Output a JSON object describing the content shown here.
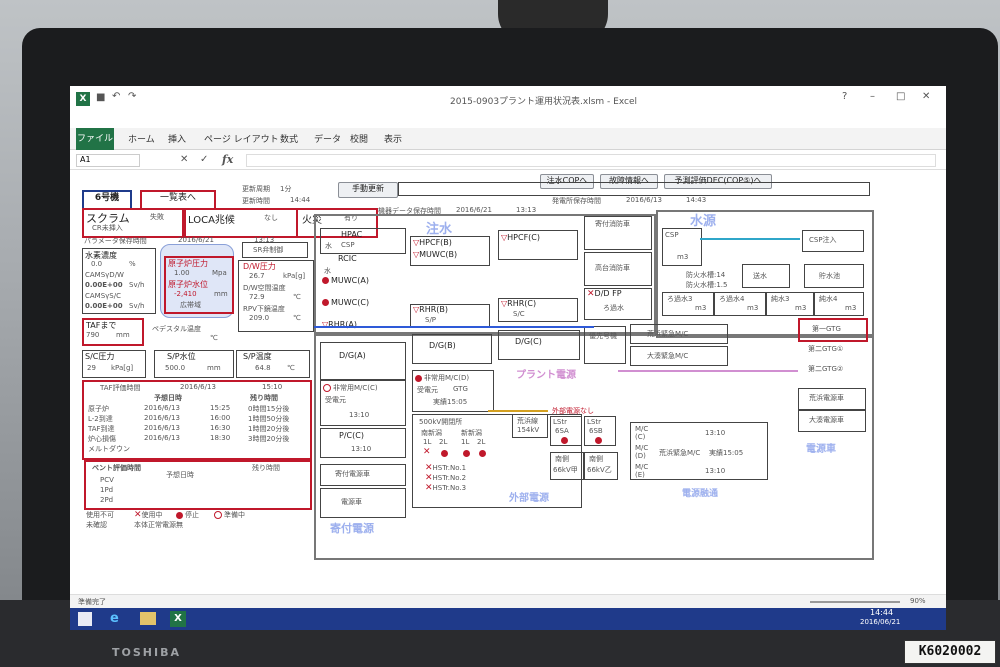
{
  "window": {
    "title": "2015-0903プラント運用状況表.xlsm - Excel"
  },
  "ribbon": {
    "tabs": [
      "ファイル",
      "ホーム",
      "挿入",
      "ページ レイアウト",
      "数式",
      "データ",
      "校閲",
      "表示"
    ]
  },
  "formula_bar": {
    "cell_ref": "A1",
    "fx": "fx"
  },
  "top_buttons": {
    "inject_cop": "注水COPへ",
    "fault_info": "故障情報へ",
    "predict": "予測評価DEC(COP⑤)へ",
    "unit": "6号機",
    "list": "一覧表へ",
    "manual_update": "手動更新"
  },
  "update": {
    "cycle_label": "更新周期",
    "cycle_value": "1分",
    "time_label": "更新時間",
    "time_value": "14:44",
    "equip_label": "機器データ保存時間",
    "equip_date": "2016/6/21",
    "equip_time": "13:13",
    "unit_label": "発電所保存時間",
    "unit_date": "2016/6/13",
    "unit_time": "14:43"
  },
  "status_row": {
    "scram": "スクラム",
    "scram_v": "失敗",
    "cr": "CR未挿入",
    "loca": "LOCA兆候",
    "loca_v": "なし",
    "fire": "火災",
    "fire_v": "有り"
  },
  "params": {
    "label": "パラメータ保存時間",
    "date": "2016/6/21",
    "time": "13:13"
  },
  "left_params": {
    "h2": "水素濃度",
    "h2_v": "0.0",
    "h2_u": "%",
    "cams_dw": "CAMSγD/W",
    "cams_dw_v": "0.00E+00",
    "cams_dw_u": "Sv/h",
    "cams_sc": "CAMSγS/C",
    "cams_sc_v": "0.00E+00",
    "cams_sc_u": "Sv/h",
    "taf": "TAFまで",
    "taf_v": "790",
    "taf_u": "mm",
    "sc_p": "S/C圧力",
    "sc_p_v": "29",
    "sc_p_u": "kPa[g]"
  },
  "reactor": {
    "pressure": "原子炉圧力",
    "pressure_v": "1.00",
    "pressure_u": "Mpa",
    "level": "原子炉水位",
    "level_v": "-2,410",
    "level_u": "mm",
    "band": "広帯域",
    "pedestal": "ペデスタル温度",
    "pedestal_u": "℃",
    "sp_level": "S/P水位",
    "sp_level_v": "500.0",
    "sp_level_u": "mm",
    "sp_temp": "S/P温度",
    "sp_temp_v": "64.8",
    "sp_temp_u": "℃"
  },
  "dw": {
    "srv": "SR弁制御",
    "dw_p": "D/W圧力",
    "dw_p_v": "26.7",
    "dw_p_u": "kPa[g]",
    "dw_t": "D/W空間温度",
    "dw_t_v": "72.9",
    "dw_t_u": "℃",
    "rpv": "RPV下鏡温度",
    "rpv_v": "209.0",
    "rpv_u": "℃"
  },
  "taf_table": {
    "title": "TAF評価時間",
    "date": "2016/6/13",
    "time": "15:10",
    "col1": "予想日時",
    "col2": "残り時間",
    "rows": [
      {
        "name": "原子炉",
        "date": "2016/6/13",
        "time": "15:25",
        "rem": "0時間15分後"
      },
      {
        "name": "L-2到達",
        "date": "2016/6/13",
        "time": "16:00",
        "rem": "1時間50分後"
      },
      {
        "name": "TAF到達",
        "date": "2016/6/13",
        "time": "16:30",
        "rem": "1時間20分後"
      },
      {
        "name": "炉心損傷",
        "date": "2016/6/13",
        "time": "18:30",
        "rem": "3時間20分後"
      },
      {
        "name": "メルトダウン",
        "date": "",
        "time": "",
        "rem": ""
      }
    ]
  },
  "vent_table": {
    "title": "ベント評価時間",
    "col1": "予想日時",
    "col2": "残り時間",
    "rows": [
      "PCV",
      "1Pd",
      "2Pd"
    ]
  },
  "legend": {
    "unusable": "使用不可",
    "unconfirmed": "未確認",
    "in_use": "使用中",
    "stopped": "停止",
    "normal": "本体正常電源無",
    "standby": "準備中"
  },
  "inject": {
    "title": "注水",
    "hpac": "HPAC",
    "rcic": "RCIC",
    "csp": "CSP",
    "water": "水",
    "muwc_a": "MUWC(A)",
    "muwc_c": "MUWC(C)",
    "muwc_b": "MUWC(B)",
    "rhr_a": "RHR(A)",
    "rhr_b": "RHR(B)",
    "rhr_c": "RHR(C)",
    "hpcf_b": "HPCF(B)",
    "hpcf_c": "HPCF(C)",
    "sp": "S/P",
    "sc": "S/C"
  },
  "fire_engine": {
    "label": "寄付消防車",
    "high": "高台消防車",
    "dd": "D/D FP",
    "ro": "ろ過水"
  },
  "water_src": {
    "title": "水源",
    "csp": "CSP",
    "csp_u": "m3",
    "csp_inj": "CSP注入",
    "tank1": "防火水槽:14",
    "tank2": "防火水槽:1.5",
    "supply": "送水",
    "reservoir": "貯水池",
    "ro3": "ろ過水3",
    "ro4": "ろ過水4",
    "pure3": "純水3",
    "pure4": "純水4",
    "u": "m3"
  },
  "power": {
    "dg_a": "D/G(A)",
    "dg_b": "D/G(B)",
    "dg_c": "D/G(C)",
    "emg_mc_c": "非常用M/C(C)",
    "emg_mc_d": "非常用M/C(D)",
    "rec": "受電元",
    "gtg": "GTG",
    "time": "13:10",
    "fixed": "実績15:05",
    "pc": "P/C(C)",
    "priority": "優先号機",
    "arahama": "荒浜緊急M/C",
    "ominato": "大湊緊急M/C",
    "gtg1": "第一GTG",
    "gtg2": "第二GTG①",
    "gtg3": "第二GTG②",
    "ar_car": "荒浜電源車",
    "om_car": "大湊電源車",
    "ext_title": "500kV開閉所",
    "minami": "南新潟",
    "shin": "新新潟",
    "arahama_line": "荒浜線",
    "arahama_kv": "154kV",
    "lstr_a": "LStr",
    "lstr_a2": "6SA",
    "lstr_b": "LStr",
    "lstr_b2": "6SB",
    "ext_none": "外部電源なし",
    "hstr1": "HSTr.No.1",
    "hstr2": "HSTr.No.2",
    "hstr3": "HSTr.No.3",
    "south1": "南側",
    "south1b": "66kV甲",
    "south2": "南側",
    "south2b": "66kV乙",
    "plant_power": "プラント電源",
    "ext_power": "外部電源",
    "donate_power": "寄付電源",
    "emg_power": "電源融通",
    "pwr_car": "電源車",
    "mc_c": "M/C",
    "mc_c2": "(C)",
    "mc_d": "M/C",
    "mc_d2": "(D)",
    "mc_e": "M/C",
    "mc_e2": "(E)",
    "p_time": "13:10",
    "p_fixed": "実績15:05",
    "p_time2": "13:10",
    "donate": "寄付電源車",
    "l1": "1L",
    "l2": "2L",
    "car": "電源車"
  },
  "status_bar": {
    "ready": "準備完了",
    "zoom": "90%"
  },
  "taskbar": {
    "time": "14:44",
    "date": "2016/06/21"
  },
  "hardware": {
    "brand": "TOSHIBA",
    "asset": "K6020002"
  }
}
